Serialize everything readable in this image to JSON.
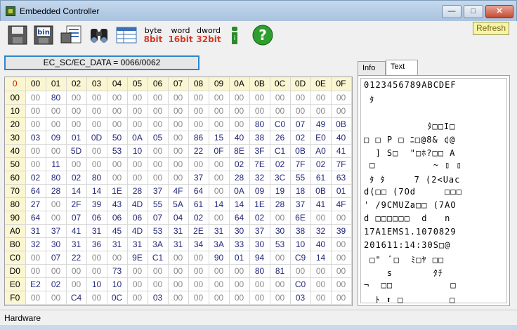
{
  "window": {
    "title": "Embedded Controller"
  },
  "toolbar": {
    "buttons": [
      {
        "name": "save-icon"
      },
      {
        "name": "bin-save-icon",
        "label": "bin"
      },
      {
        "name": "print-grid-icon"
      },
      {
        "name": "binoculars-icon"
      },
      {
        "name": "table-view-icon"
      },
      {
        "name": "byte-mode-icon",
        "top": "byte",
        "bottom": "8bit",
        "color": "#d23a2a"
      },
      {
        "name": "word-mode-icon",
        "top": "word",
        "bottom": "16bit",
        "color": "#d23a2a"
      },
      {
        "name": "dword-mode-icon",
        "top": "dword",
        "bottom": "32bit",
        "color": "#d23a2a"
      },
      {
        "name": "info-icon",
        "label": "i"
      },
      {
        "name": "help-icon",
        "label": "?"
      }
    ],
    "refresh_label": "Refresh"
  },
  "address": "EC_SC/EC_DATA = 0066/0062",
  "grid": {
    "corner": "0",
    "columns": [
      "00",
      "01",
      "02",
      "03",
      "04",
      "05",
      "06",
      "07",
      "08",
      "09",
      "0A",
      "0B",
      "0C",
      "0D",
      "0E",
      "0F"
    ],
    "rows": [
      {
        "addr": "00",
        "cells": [
          "00",
          "80",
          "00",
          "00",
          "00",
          "00",
          "00",
          "00",
          "00",
          "00",
          "00",
          "00",
          "00",
          "00",
          "00",
          "00"
        ]
      },
      {
        "addr": "10",
        "cells": [
          "00",
          "00",
          "00",
          "00",
          "00",
          "00",
          "00",
          "00",
          "00",
          "00",
          "00",
          "00",
          "00",
          "00",
          "00",
          "00"
        ]
      },
      {
        "addr": "20",
        "cells": [
          "00",
          "00",
          "00",
          "00",
          "00",
          "00",
          "00",
          "00",
          "00",
          "00",
          "00",
          "80",
          "C0",
          "07",
          "49",
          "0B"
        ]
      },
      {
        "addr": "30",
        "cells": [
          "03",
          "09",
          "01",
          "0D",
          "50",
          "0A",
          "05",
          "00",
          "86",
          "15",
          "40",
          "38",
          "26",
          "02",
          "E0",
          "40"
        ]
      },
      {
        "addr": "40",
        "cells": [
          "00",
          "00",
          "5D",
          "00",
          "53",
          "10",
          "00",
          "00",
          "22",
          "0F",
          "8E",
          "3F",
          "C1",
          "0B",
          "A0",
          "41"
        ]
      },
      {
        "addr": "50",
        "cells": [
          "00",
          "11",
          "00",
          "00",
          "00",
          "00",
          "00",
          "00",
          "00",
          "00",
          "02",
          "7E",
          "02",
          "7F",
          "02",
          "7F"
        ]
      },
      {
        "addr": "60",
        "cells": [
          "02",
          "80",
          "02",
          "80",
          "00",
          "00",
          "00",
          "00",
          "37",
          "00",
          "28",
          "32",
          "3C",
          "55",
          "61",
          "63"
        ]
      },
      {
        "addr": "70",
        "cells": [
          "64",
          "28",
          "14",
          "14",
          "1E",
          "28",
          "37",
          "4F",
          "64",
          "00",
          "0A",
          "09",
          "19",
          "18",
          "0B",
          "01"
        ]
      },
      {
        "addr": "80",
        "cells": [
          "27",
          "00",
          "2F",
          "39",
          "43",
          "4D",
          "55",
          "5A",
          "61",
          "14",
          "14",
          "1E",
          "28",
          "37",
          "41",
          "4F"
        ]
      },
      {
        "addr": "90",
        "cells": [
          "64",
          "00",
          "07",
          "06",
          "06",
          "06",
          "07",
          "04",
          "02",
          "00",
          "64",
          "02",
          "00",
          "6E",
          "00",
          "00"
        ]
      },
      {
        "addr": "A0",
        "cells": [
          "31",
          "37",
          "41",
          "31",
          "45",
          "4D",
          "53",
          "31",
          "2E",
          "31",
          "30",
          "37",
          "30",
          "38",
          "32",
          "39"
        ]
      },
      {
        "addr": "B0",
        "cells": [
          "32",
          "30",
          "31",
          "36",
          "31",
          "31",
          "3A",
          "31",
          "34",
          "3A",
          "33",
          "30",
          "53",
          "10",
          "40",
          "00"
        ]
      },
      {
        "addr": "C0",
        "cells": [
          "00",
          "07",
          "22",
          "00",
          "00",
          "9E",
          "C1",
          "00",
          "00",
          "90",
          "01",
          "94",
          "00",
          "C9",
          "14",
          "00"
        ]
      },
      {
        "addr": "D0",
        "cells": [
          "00",
          "00",
          "00",
          "00",
          "73",
          "00",
          "00",
          "00",
          "00",
          "00",
          "00",
          "80",
          "81",
          "00",
          "00",
          "00"
        ]
      },
      {
        "addr": "E0",
        "cells": [
          "E2",
          "02",
          "00",
          "10",
          "10",
          "00",
          "00",
          "00",
          "00",
          "00",
          "00",
          "00",
          "00",
          "C0",
          "00",
          "00"
        ]
      },
      {
        "addr": "F0",
        "cells": [
          "00",
          "00",
          "C4",
          "00",
          "0C",
          "00",
          "03",
          "00",
          "00",
          "00",
          "00",
          "00",
          "00",
          "03",
          "00",
          "00"
        ]
      }
    ]
  },
  "tabs": {
    "info": "Info",
    "text": "Text"
  },
  "text_view": {
    "header": "0123456789ABCDEF",
    "lines": [
      " ﾀ",
      "",
      "           ﾀ□□I□",
      "□ □ P □ ﾆ□@8& ¢@",
      "  ] S□  \"□ﾎ?□□ A",
      " □          ~ ▯ ▯",
      " ﾀ ﾀ     7 (2<Uac",
      "d(□□ (7Od     □□□",
      "' /9CMUZa□□ (7AO",
      "d □□□□□□  d   n",
      "17A1EMS1.1070829",
      "201611:14:30S□@",
      " □\"  ﾞ□  ﾐ□ﾔ □□",
      "    s       ﾀﾁ",
      "¬  □□          □",
      "  ﾄ ⬆ □        □"
    ]
  },
  "status": {
    "text": "Hardware"
  }
}
